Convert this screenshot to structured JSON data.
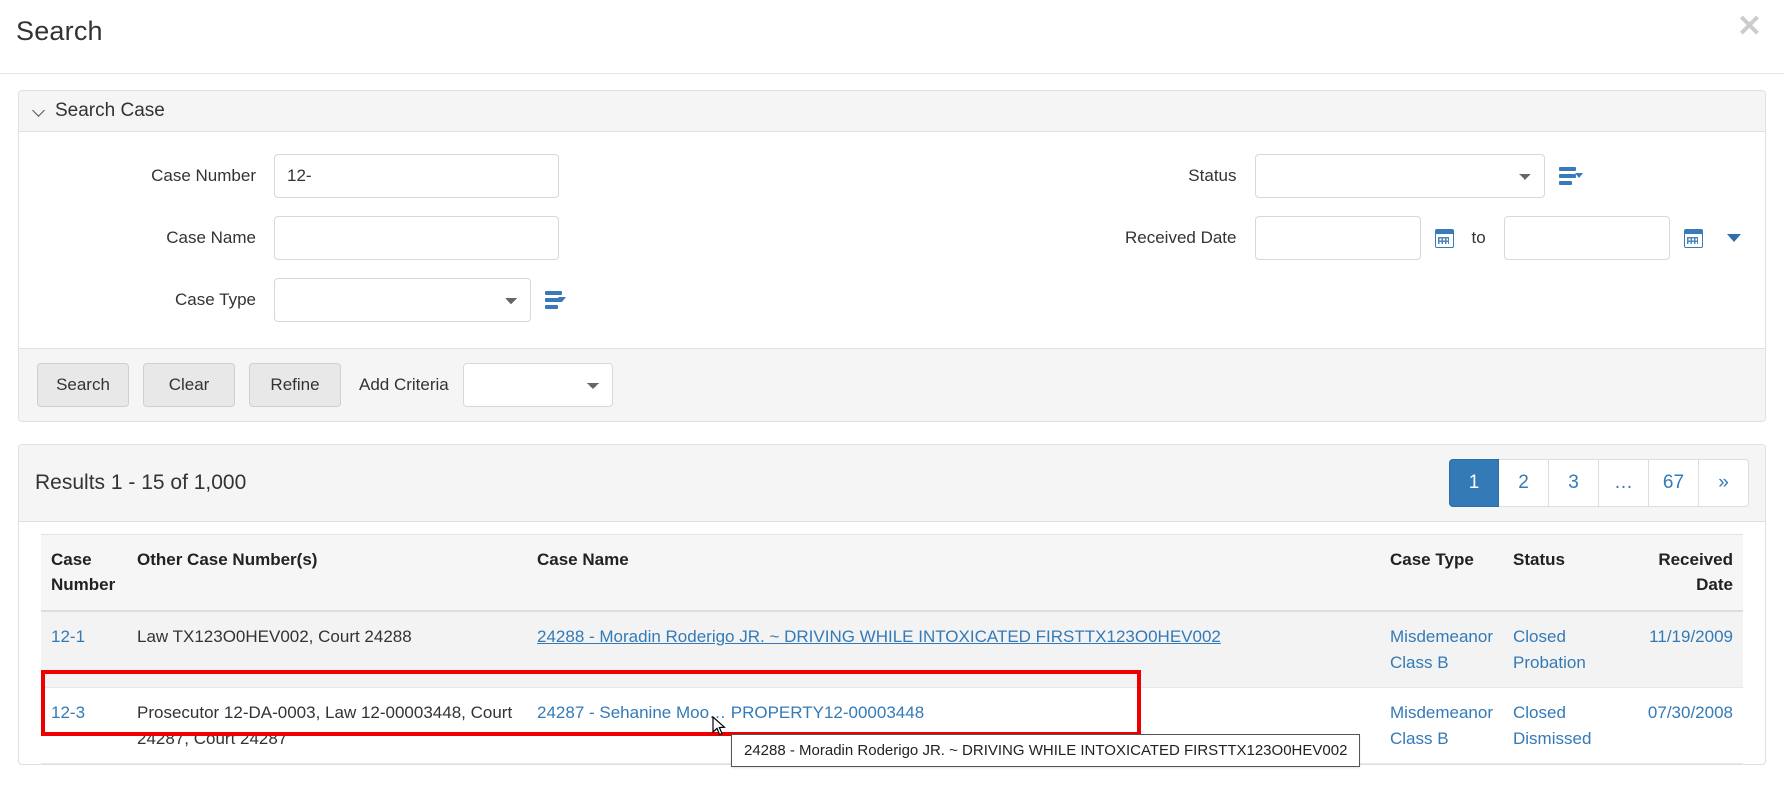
{
  "header": {
    "title": "Search",
    "close_label": "✕"
  },
  "search_panel": {
    "title": "Search Case",
    "collapse_icon": "chevron-down-icon",
    "fields": {
      "case_number": {
        "label": "Case Number",
        "value": "12-",
        "placeholder": ""
      },
      "case_name": {
        "label": "Case Name",
        "value": "",
        "placeholder": ""
      },
      "case_type": {
        "label": "Case Type",
        "value": "",
        "placeholder": ""
      },
      "status": {
        "label": "Status",
        "value": "",
        "placeholder": ""
      },
      "received_date": {
        "label": "Received Date",
        "from_value": "",
        "to_label": "to",
        "to_value": ""
      }
    },
    "icons": {
      "case_type_filter": "filter-list-icon",
      "status_filter": "filter-list-icon",
      "date_from_calendar": "calendar-icon",
      "date_to_calendar": "calendar-icon",
      "date_more": "caret-down-icon"
    }
  },
  "actions": {
    "search_label": "Search",
    "clear_label": "Clear",
    "refine_label": "Refine",
    "add_criteria_label": "Add Criteria",
    "add_criteria_value": ""
  },
  "results": {
    "count_text": "Results 1 - 15 of 1,000",
    "pagination": [
      {
        "label": "1",
        "active": true
      },
      {
        "label": "2",
        "active": false
      },
      {
        "label": "3",
        "active": false
      },
      {
        "label": "…",
        "active": false
      },
      {
        "label": "67",
        "active": false
      },
      {
        "label": "»",
        "active": false
      }
    ],
    "columns": [
      "Case Number",
      "Other Case Number(s)",
      "Case Name",
      "Case Type",
      "Status",
      "Received Date"
    ],
    "rows": [
      {
        "case_number": "12-1",
        "other_case_numbers": "Law TX123O0HEV002, Court 24288",
        "case_name": "24288 - Moradin Roderigo JR. ~ DRIVING WHILE INTOXICATED FIRSTTX123O0HEV002",
        "case_type": "Misdemeanor Class B",
        "status": "Closed Probation",
        "received_date": "11/19/2009",
        "highlighted": true
      },
      {
        "case_number": "12-3",
        "other_case_numbers": "Prosecutor 12-DA-0003, Law 12-00003448, Court 24287, Court 24287",
        "case_name": "24287 - Sehanine Moo… PROPERTY12-00003448",
        "case_type": "Misdemeanor Class B",
        "status": "Closed Dismissed",
        "received_date": "07/30/2008",
        "highlighted": false
      }
    ]
  },
  "tooltip": {
    "text": "24288 - Moradin Roderigo JR. ~ DRIVING WHILE INTOXICATED FIRSTTX123O0HEV002"
  },
  "colors": {
    "link": "#337ab7",
    "active_page_bg": "#337ab7",
    "highlight_box": "#ee0000",
    "icon_blue": "#3a7ab8",
    "panel_header_bg": "#f5f5f5"
  }
}
